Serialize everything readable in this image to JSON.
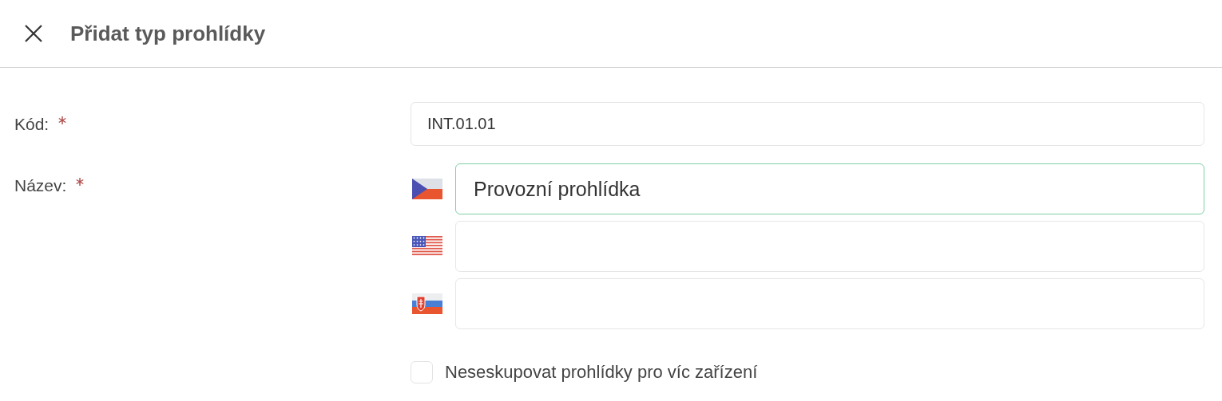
{
  "dialog": {
    "title": "Přidat typ prohlídky"
  },
  "fields": [
    {
      "kind": "text",
      "label": "Kód:",
      "required": true,
      "value": "INT.01.01"
    },
    {
      "kind": "translations",
      "label": "Název:",
      "required": true,
      "translations": [
        {
          "kind": "cs",
          "value": "Provozní prohlídka",
          "focused": true
        },
        {
          "kind": "us",
          "focused": false
        },
        {
          "kind": "sk",
          "focused": false
        }
      ]
    }
  ],
  "checkbox": {
    "label": "Neseskupovat prohlídky pro víc zařízení",
    "checked": false
  }
}
